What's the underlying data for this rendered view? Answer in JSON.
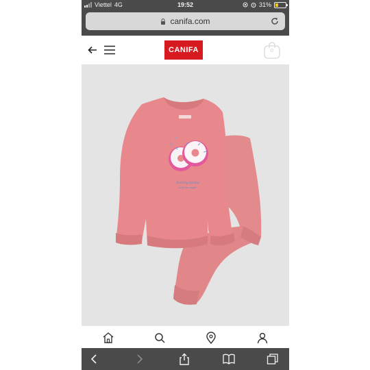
{
  "status_bar": {
    "carrier": "Viettel",
    "network": "4G",
    "time": "19:52",
    "battery_percent": "31%",
    "battery_level": 0.31
  },
  "browser": {
    "url": "canifa.com"
  },
  "site": {
    "logo_text": "CANIFA",
    "cart_count": "0",
    "brand_color": "#d71920"
  },
  "product": {
    "print_line1": "feeling funky",
    "print_line2": "and so sugar",
    "garment_color": "#e8888c"
  },
  "bottom_nav": {
    "items": [
      "home-icon",
      "search-icon",
      "location-pin-icon",
      "user-icon"
    ]
  },
  "safari_toolbar": {
    "items": [
      "back-icon",
      "forward-icon",
      "share-icon",
      "bookmarks-icon",
      "tabs-icon"
    ]
  }
}
